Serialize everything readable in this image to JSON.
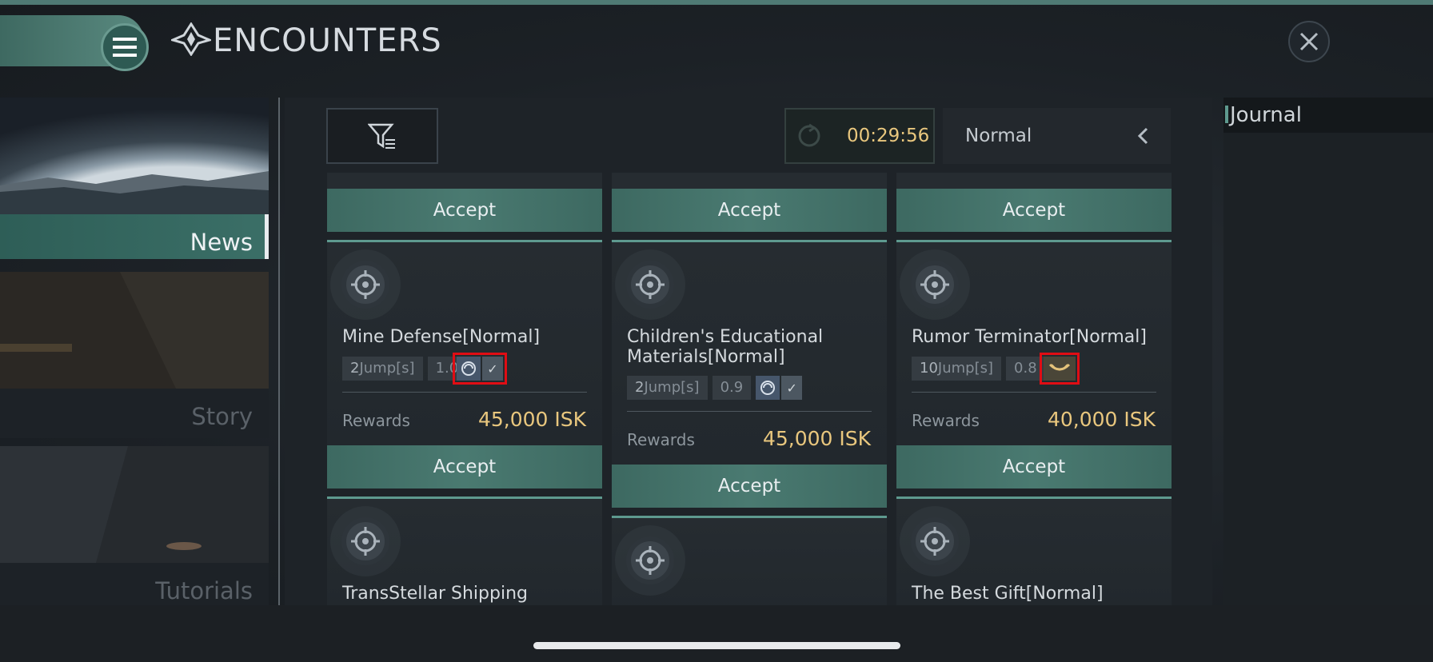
{
  "header": {
    "title": "ENCOUNTERS"
  },
  "sidebar": {
    "items": [
      {
        "label": "News",
        "active": true
      },
      {
        "label": "Story",
        "active": false
      },
      {
        "label": "Tutorials",
        "active": false
      }
    ]
  },
  "toolbar": {
    "timer": "00:29:56",
    "mode": "Normal"
  },
  "journal": {
    "title": "Journal"
  },
  "accept_label": "Accept",
  "rewards_label": "Rewards",
  "columns": [
    {
      "cards": [
        {
          "title": "Mine Defense[Normal]",
          "jumps_num": "2",
          "jumps_unit": "Jump[s]",
          "security": "1.0",
          "rewards": "45,000 ISK"
        },
        {
          "title": "TransStellar Shipping"
        }
      ]
    },
    {
      "cards": [
        {
          "title_line1": "Children's Educational",
          "title_line2": "Materials[Normal]",
          "jumps_num": "2",
          "jumps_unit": "Jump[s]",
          "security": "0.9",
          "rewards": "45,000 ISK"
        },
        {
          "title": ""
        }
      ]
    },
    {
      "cards": [
        {
          "title": "Rumor Terminator[Normal]",
          "jumps_num": "10",
          "jumps_unit": "Jump[s]",
          "security": "0.8",
          "rewards": "40,000 ISK"
        },
        {
          "title": "The Best Gift[Normal]"
        }
      ]
    }
  ],
  "colors": {
    "accent": "#4a7a71",
    "reward": "#e9c77e",
    "highlight": "#e00d14"
  },
  "icons": [
    "menu-icon",
    "encounters-logo-icon",
    "close-icon",
    "filter-icon",
    "refresh-icon",
    "chevron-left-icon",
    "mission-badge-icon",
    "standing-icon",
    "check-icon",
    "mining-icon"
  ]
}
